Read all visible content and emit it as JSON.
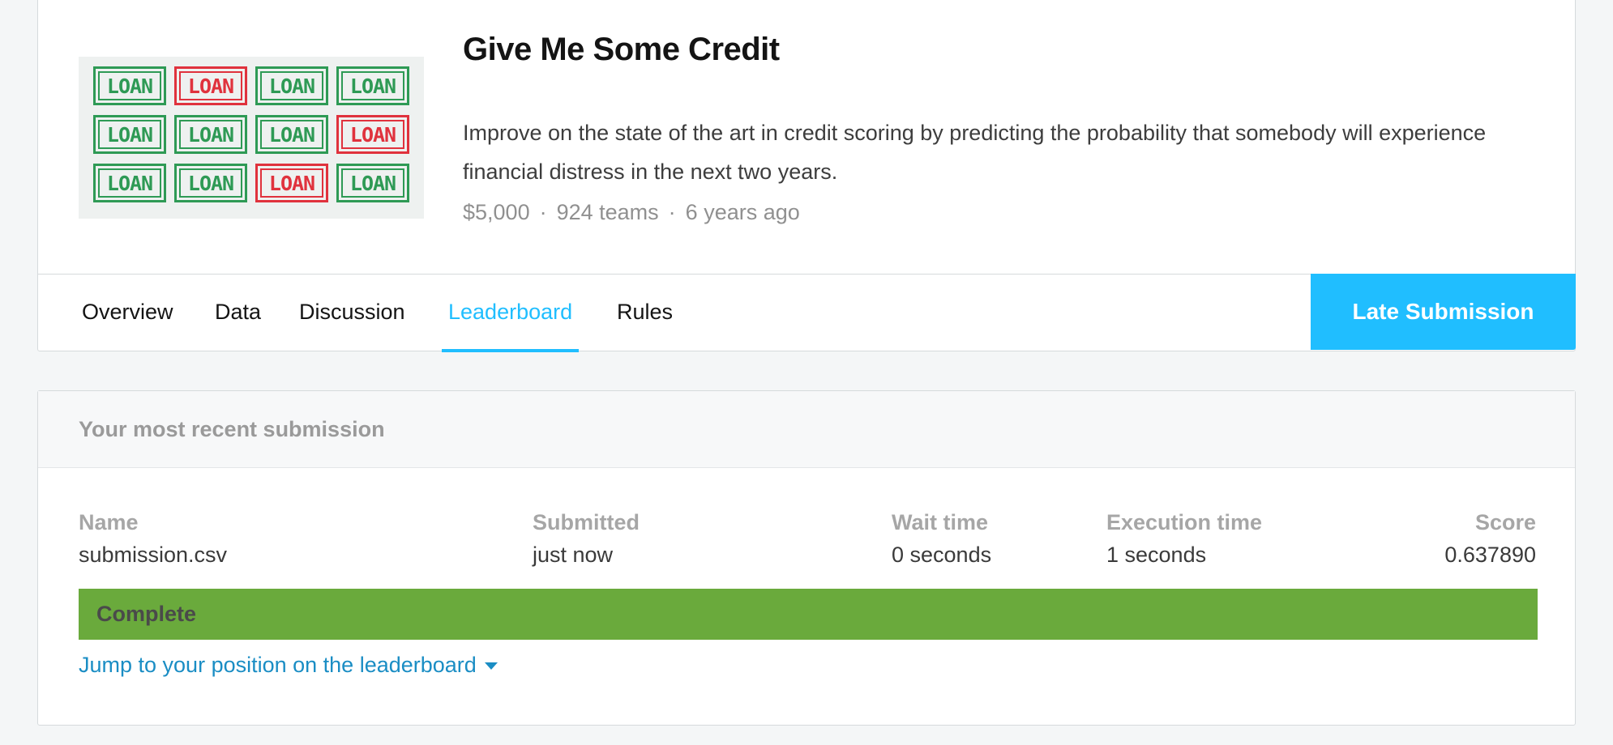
{
  "competition": {
    "title": "Give Me Some Credit",
    "description": "Improve on the state of the art in credit scoring by predicting the probability that somebody will experience financial distress in the next two years.",
    "prize": "$5,000",
    "teams": "924 teams",
    "age": "6 years ago",
    "meta_separator": "·",
    "banner": {
      "stamp_text": "LOAN",
      "stamp_colors": [
        "green",
        "red",
        "green",
        "green",
        "green",
        "green",
        "green",
        "red",
        "green",
        "green",
        "red",
        "green"
      ]
    }
  },
  "tabs": [
    {
      "label": "Overview"
    },
    {
      "label": "Data"
    },
    {
      "label": "Discussion"
    },
    {
      "label": "Leaderboard",
      "active": true
    },
    {
      "label": "Rules"
    }
  ],
  "late_submission_label": "Late Submission",
  "submission": {
    "header": "Your most recent submission",
    "columns": {
      "name": {
        "label": "Name",
        "value": "submission.csv"
      },
      "submitted": {
        "label": "Submitted",
        "value": "just now"
      },
      "wait": {
        "label": "Wait time",
        "value": "0 seconds"
      },
      "exec": {
        "label": "Execution time",
        "value": "1 seconds"
      },
      "score": {
        "label": "Score",
        "value": "0.637890"
      }
    },
    "status": "Complete",
    "jump_link": "Jump to your position on the leaderboard"
  },
  "colors": {
    "accent": "#20beff",
    "complete": "#6aaa3c",
    "link": "#1a8dc4",
    "stamp_green": "#2e9a55",
    "stamp_red": "#e0323d"
  }
}
